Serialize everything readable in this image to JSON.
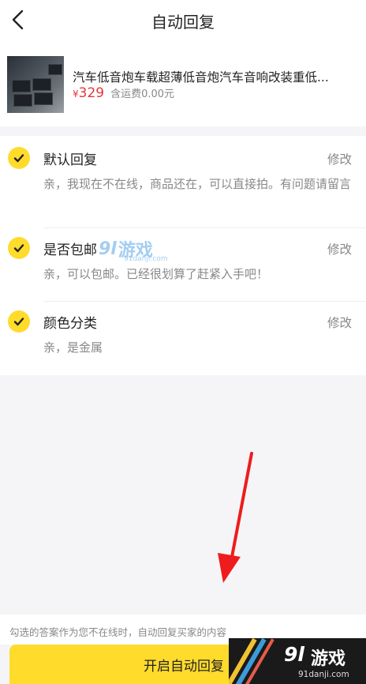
{
  "header": {
    "title": "自动回复"
  },
  "product": {
    "title": "汽车低音炮车载超薄低音炮汽车音响改装重低...",
    "currency": "¥",
    "price": "329",
    "shipping": "含运费0.00元"
  },
  "replies": [
    {
      "title": "默认回复",
      "edit_label": "修改",
      "content": "亲，我现在不在线，商品还在，可以直接拍。有问题请留言"
    },
    {
      "title": "是否包邮",
      "edit_label": "修改",
      "content": "亲，可以包邮。已经很划算了赶紧入手吧！"
    },
    {
      "title": "颜色分类",
      "edit_label": "修改",
      "content": "亲，是金属"
    }
  ],
  "footer": {
    "note": "勾选的答案作为您不在线时，自动回复买家的内容",
    "cta_label": "开启自动回复"
  },
  "watermark": {
    "logo": "9l",
    "name": "游戏",
    "site": "91danji.com"
  },
  "colors": {
    "accent": "#ffdb2c",
    "price": "#e6353b",
    "arrow": "#ee1c1c"
  }
}
